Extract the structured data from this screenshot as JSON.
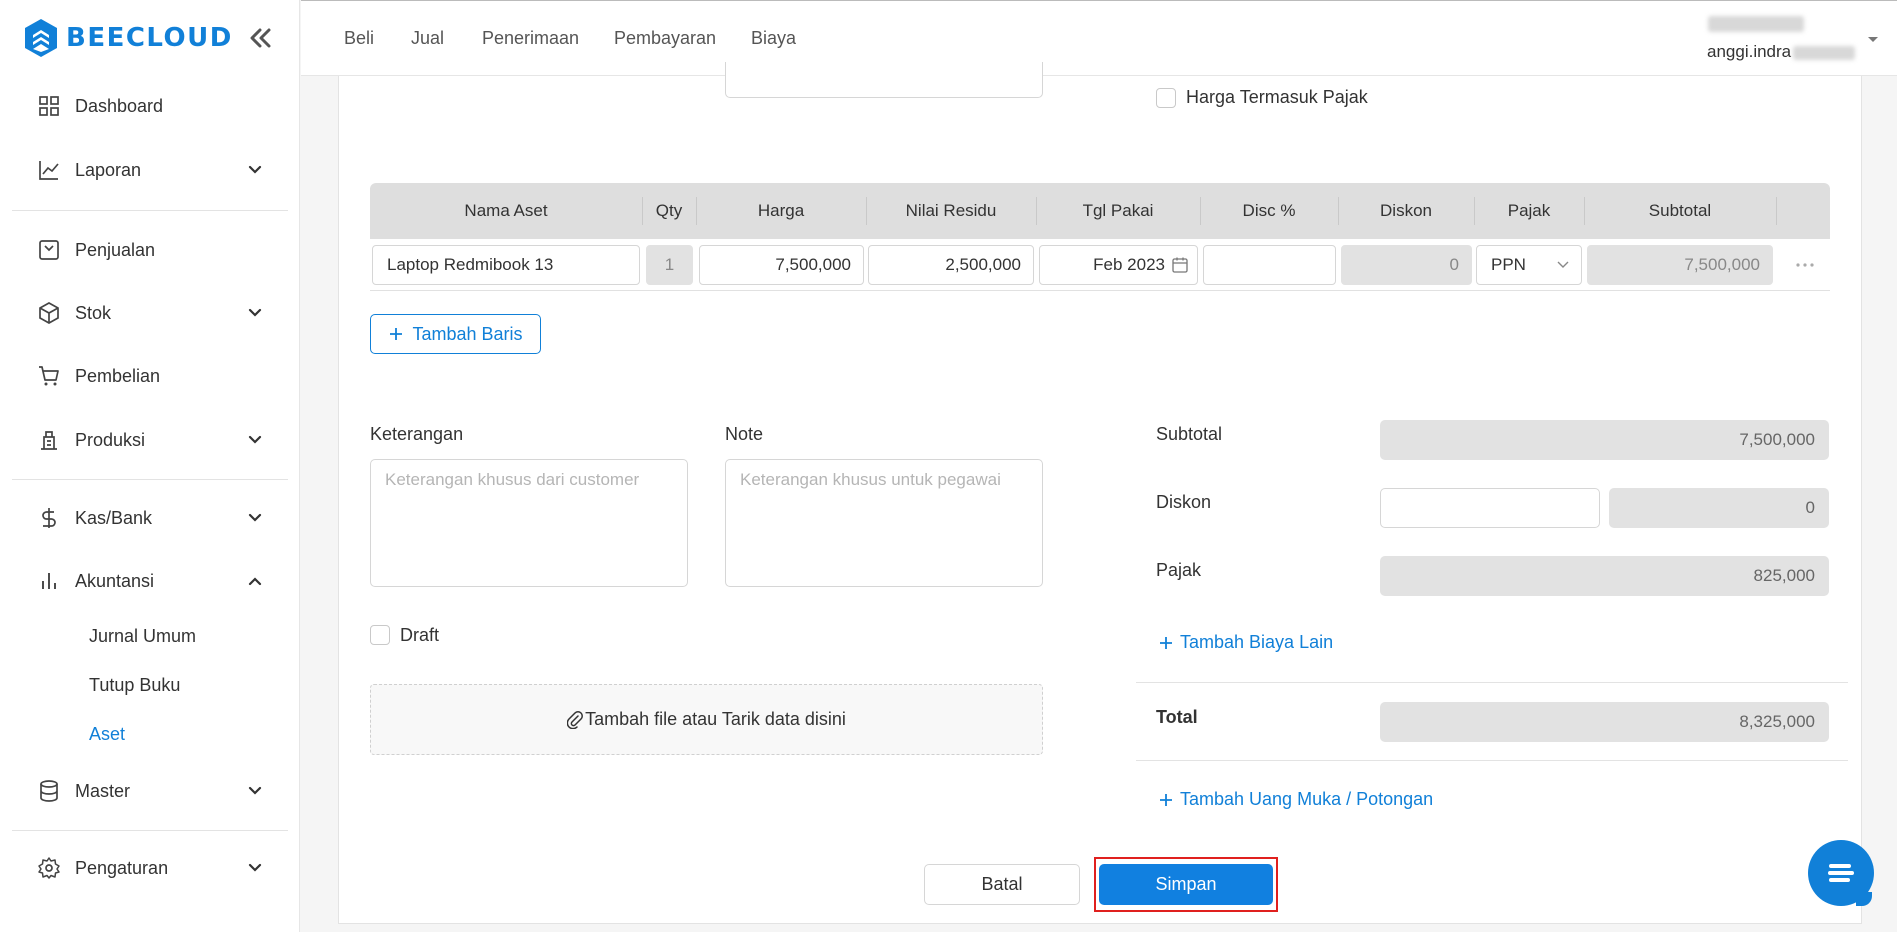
{
  "brand": {
    "name": "BEECLOUD",
    "color": "#1180d8"
  },
  "sidebar": {
    "items": [
      {
        "label": "Dashboard",
        "icon": "grid-icon"
      },
      {
        "label": "Laporan",
        "icon": "chart-line-icon"
      },
      {
        "label": "Penjualan",
        "icon": "sales-icon"
      },
      {
        "label": "Stok",
        "icon": "box-icon"
      },
      {
        "label": "Pembelian",
        "icon": "cart-icon"
      },
      {
        "label": "Produksi",
        "icon": "factory-icon"
      },
      {
        "label": "Kas/Bank",
        "icon": "dollar-icon"
      },
      {
        "label": "Akuntansi",
        "icon": "bar-chart-icon"
      },
      {
        "label": "Master",
        "icon": "database-icon"
      },
      {
        "label": "Pengaturan",
        "icon": "gear-icon"
      }
    ],
    "submenu": [
      "Jurnal Umum",
      "Tutup Buku",
      "Aset"
    ],
    "active_sub": "Aset"
  },
  "topnav": [
    "Beli",
    "Jual",
    "Penerimaan",
    "Pembayaran",
    "Biaya"
  ],
  "user": {
    "email": "anggi.indra"
  },
  "form": {
    "tax_included_label": "Harga Termasuk Pajak",
    "table": {
      "columns": [
        "Nama Aset",
        "Qty",
        "Harga",
        "Nilai Residu",
        "Tgl Pakai",
        "Disc %",
        "Diskon",
        "Pajak",
        "Subtotal"
      ],
      "rows": [
        {
          "nama": "Laptop Redmibook 13",
          "qty": "1",
          "harga": "7,500,000",
          "residu": "2,500,000",
          "tgl": "Feb 2023",
          "disc_pct": "",
          "diskon": "0",
          "pajak": "PPN",
          "subtotal": "7,500,000"
        }
      ]
    },
    "add_row_label": "Tambah Baris",
    "keterangan": {
      "label": "Keterangan",
      "placeholder": "Keterangan khusus dari customer"
    },
    "note": {
      "label": "Note",
      "placeholder": "Keterangan khusus untuk pegawai"
    },
    "draft_label": "Draft",
    "dropzone_label": "Tambah file atau Tarik data disini"
  },
  "summary": {
    "subtotal_label": "Subtotal",
    "subtotal": "7,500,000",
    "diskon_label": "Diskon",
    "diskon": "0",
    "pajak_label": "Pajak",
    "pajak": "825,000",
    "add_cost_label": "Tambah Biaya Lain",
    "total_label": "Total",
    "total": "8,325,000",
    "add_advance_label": "Tambah Uang Muka / Potongan"
  },
  "actions": {
    "cancel": "Batal",
    "save": "Simpan"
  },
  "colors": {
    "accent": "#1180d8",
    "highlight": "#e0201e"
  }
}
